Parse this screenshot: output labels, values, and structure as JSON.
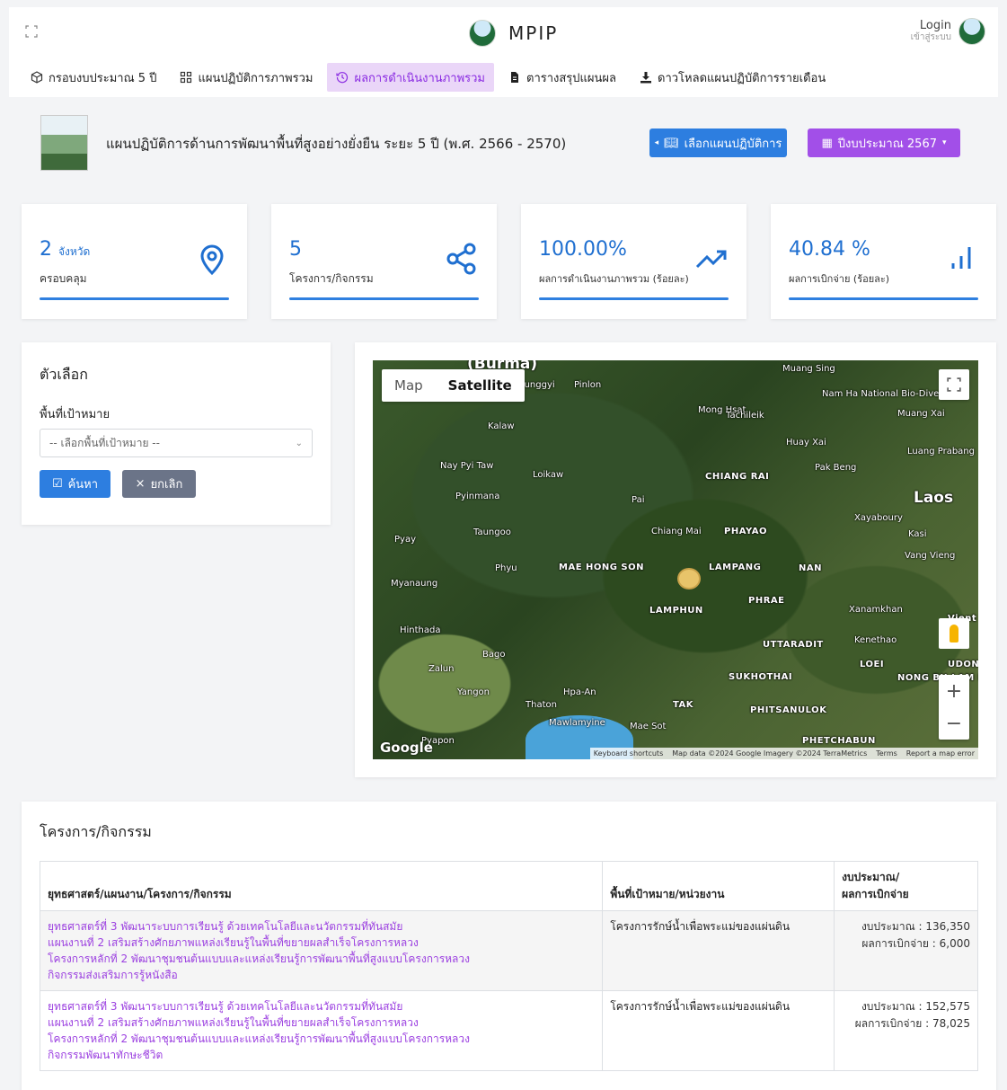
{
  "header": {
    "brand": "MPIP",
    "login_label": "Login",
    "login_sub": "เข้าสู่ระบบ"
  },
  "menu": [
    {
      "label": "กรอบงบประมาณ 5 ปี",
      "icon": "cube-icon",
      "active": false
    },
    {
      "label": "แผนปฏิบัติการภาพรวม",
      "icon": "grid-icon",
      "active": false
    },
    {
      "label": "ผลการดำเนินงานภาพรวม",
      "icon": "history-icon",
      "active": true
    },
    {
      "label": "ตารางสรุปแผนผล",
      "icon": "file-icon",
      "active": false
    },
    {
      "label": "ดาวโหลดแผนปฏิบัติการรายเดือน",
      "icon": "download-icon",
      "active": false
    }
  ],
  "plan": {
    "title": "แผนปฏิบัติการด้านการพัฒนาพื้นที่สูงอย่างยั่งยืน ระยะ 5 ปี (พ.ศ. 2566 - 2570)",
    "select_plan_button": "เลือกแผนปฏิบัติการ",
    "year_button": "ปีงบประมาณ 2567"
  },
  "stats": [
    {
      "value": "2",
      "unit": "จังหวัด",
      "label": "ครอบคลุม",
      "icon": "map-pin-icon"
    },
    {
      "value": "5",
      "unit": "",
      "label": "โครงการ/กิจกรรม",
      "icon": "share-icon"
    },
    {
      "value": "100.00%",
      "unit": "",
      "label": "ผลการดำเนินงานภาพรวม (ร้อยละ)",
      "icon": "trend-up-icon"
    },
    {
      "value": "40.84 %",
      "unit": "",
      "label": "ผลการเบิกจ่าย (ร้อยละ)",
      "icon": "bar-chart-icon"
    }
  ],
  "options": {
    "title": "ตัวเลือก",
    "area_label": "พื้นที่เป้าหมาย",
    "area_placeholder": "-- เลือกพื้นที่เป้าหมาย --",
    "search_button": "ค้นหา",
    "cancel_button": "ยกเลิก"
  },
  "map": {
    "type_map": "Map",
    "type_satellite": "Satellite",
    "google": "Google",
    "attribution": [
      "Keyboard shortcuts",
      "Map data ©2024 Google Imagery ©2024 TerraMetrics",
      "Terms",
      "Report a map error"
    ],
    "labels": [
      {
        "t": "(Burma)",
        "k": "big"
      },
      {
        "t": "Taunggyi",
        "k": ""
      },
      {
        "t": "Pinlon",
        "k": ""
      },
      {
        "t": "Muang Sing",
        "k": ""
      },
      {
        "t": "Nam Ha National Bio-Diversity...",
        "k": ""
      },
      {
        "t": "Muang Xai",
        "k": ""
      },
      {
        "t": "Mong Hsat",
        "k": ""
      },
      {
        "t": "Tachileik",
        "k": ""
      },
      {
        "t": "Kalaw",
        "k": ""
      },
      {
        "t": "Huay Xai",
        "k": ""
      },
      {
        "t": "Luang Prabang",
        "k": ""
      },
      {
        "t": "Pak Beng",
        "k": ""
      },
      {
        "t": "Nay Pyi Taw",
        "k": ""
      },
      {
        "t": "Loikaw",
        "k": ""
      },
      {
        "t": "CHIANG RAI",
        "k": "prov"
      },
      {
        "t": "Laos",
        "k": "big"
      },
      {
        "t": "Pyinmana",
        "k": ""
      },
      {
        "t": "Pai",
        "k": ""
      },
      {
        "t": "Xayaboury",
        "k": ""
      },
      {
        "t": "Chiang Mai",
        "k": ""
      },
      {
        "t": "PHAYAO",
        "k": "prov"
      },
      {
        "t": "Kasi",
        "k": ""
      },
      {
        "t": "Taungoo",
        "k": ""
      },
      {
        "t": "Pyay",
        "k": ""
      },
      {
        "t": "Vang Vieng",
        "k": ""
      },
      {
        "t": "Phyu",
        "k": ""
      },
      {
        "t": "MAE HONG SON",
        "k": "prov"
      },
      {
        "t": "LAMPANG",
        "k": "prov"
      },
      {
        "t": "NAN",
        "k": "prov"
      },
      {
        "t": "Myanaung",
        "k": ""
      },
      {
        "t": "PHRAE",
        "k": "prov"
      },
      {
        "t": "LAMPHUN",
        "k": "prov"
      },
      {
        "t": "Xanamkhan",
        "k": ""
      },
      {
        "t": "Hinthada",
        "k": ""
      },
      {
        "t": "UTTARADIT",
        "k": "prov"
      },
      {
        "t": "Kenethao",
        "k": ""
      },
      {
        "t": "LOEI",
        "k": "prov"
      },
      {
        "t": "Bago",
        "k": ""
      },
      {
        "t": "UDON TH",
        "k": "prov"
      },
      {
        "t": "Zalun",
        "k": ""
      },
      {
        "t": "SUKHOTHAI",
        "k": "prov"
      },
      {
        "t": "NONG BU LAM PH",
        "k": "prov"
      },
      {
        "t": "Yangon",
        "k": ""
      },
      {
        "t": "Hpa-An",
        "k": ""
      },
      {
        "t": "Thaton",
        "k": ""
      },
      {
        "t": "TAK",
        "k": "prov"
      },
      {
        "t": "PHITSANULOK",
        "k": "prov"
      },
      {
        "t": "Mawlamyine",
        "k": ""
      },
      {
        "t": "Mae Sot",
        "k": ""
      },
      {
        "t": "PHETCHABUN",
        "k": "prov"
      },
      {
        "t": "Pyapon",
        "k": ""
      },
      {
        "t": "Vient",
        "k": "prov"
      }
    ]
  },
  "projects": {
    "title": "โครงการ/กิจกรรม",
    "headers": [
      "ยุทธศาสตร์/แผนงาน/โครงการ/กิจกรรม",
      "พื้นที่เป้าหมาย/หน่วยงาน",
      "งบประมาณ/\nผลการเบิกจ่าย"
    ],
    "rows": [
      {
        "lines": [
          "ยุทธศาสตร์ที่ 3 พัฒนาระบบการเรียนรู้ ด้วยเทคโนโลยีและนวัตกรรมที่ทันสมัย",
          "แผนงานที่ 2 เสริมสร้างศักยภาพแหล่งเรียนรู้ในพื้นที่ขยายผลสำเร็จโครงการหลวง",
          "โครงการหลักที่ 2 พัฒนาชุมชนต้นแบบและแหล่งเรียนรู้การพัฒนาพื้นที่สูงแบบโครงการหลวง",
          "กิจกรรมส่งเสริมการรู้หนังสือ"
        ],
        "area": "โครงการรักษ์น้ำเพื่อพระแม่ของแผ่นดิน",
        "budget": "งบประมาณ : 136,350",
        "spent": "ผลการเบิกจ่าย : 6,000"
      },
      {
        "lines": [
          "ยุทธศาสตร์ที่ 3 พัฒนาระบบการเรียนรู้ ด้วยเทคโนโลยีและนวัตกรรมที่ทันสมัย",
          "แผนงานที่ 2 เสริมสร้างศักยภาพแหล่งเรียนรู้ในพื้นที่ขยายผลสำเร็จโครงการหลวง",
          "โครงการหลักที่ 2 พัฒนาชุมชนต้นแบบและแหล่งเรียนรู้การพัฒนาพื้นที่สูงแบบโครงการหลวง",
          "กิจกรรมพัฒนาทักษะชีวิต"
        ],
        "area": "โครงการรักษ์น้ำเพื่อพระแม่ของแผ่นดิน",
        "budget": "งบประมาณ : 152,575",
        "spent": "ผลการเบิกจ่าย : 78,025"
      }
    ]
  }
}
